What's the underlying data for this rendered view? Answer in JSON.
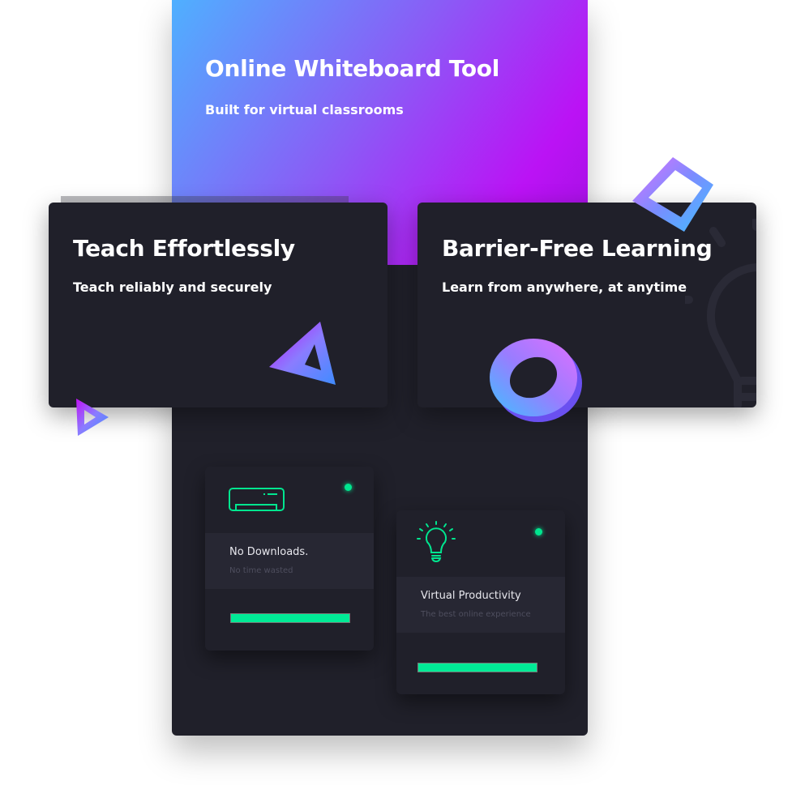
{
  "hero": {
    "title": "Online Whiteboard Tool",
    "subtitle": "Built for virtual classrooms"
  },
  "cards": [
    {
      "title": "Teach Effortlessly",
      "subtitle": "Teach reliably and securely"
    },
    {
      "title": "Barrier-Free Learning",
      "subtitle": "Learn from anywhere, at anytime"
    }
  ],
  "features": [
    {
      "icon": "air-conditioner-icon",
      "title": "No Downloads.",
      "subtitle": "No time wasted",
      "progress": 100,
      "status_color": "#00e68f"
    },
    {
      "icon": "lightbulb-icon",
      "title": "Virtual Productivity",
      "subtitle": "The best online experience",
      "progress": 100,
      "status_color": "#00e68f"
    }
  ],
  "colors": {
    "accent": "#00ea96",
    "gradient_start": "#4fb0ff",
    "gradient_end": "#bb12f5",
    "panel": "#20202a"
  }
}
